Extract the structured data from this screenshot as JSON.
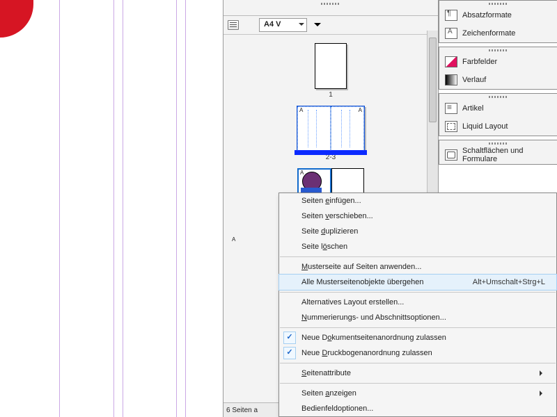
{
  "toolbar": {
    "page_template_label": "A4 V"
  },
  "pages": {
    "label_1": "1",
    "label_23": "2-3",
    "status": "6 Seiten a"
  },
  "right_panels": {
    "absatzformate": "Absatzformate",
    "zeichenformate": "Zeichenformate",
    "farbfelder": "Farbfelder",
    "verlauf": "Verlauf",
    "artikel": "Artikel",
    "liquid_layout": "Liquid Layout",
    "schaltflaechen": "Schaltflächen und Formulare"
  },
  "context_menu": {
    "seiten_einfuegen": {
      "pre": "Seiten ",
      "u": "e",
      "post": "infügen..."
    },
    "seiten_verschieben": {
      "pre": "Seiten ",
      "u": "v",
      "post": "erschieben..."
    },
    "seite_duplizieren": {
      "pre": "Seite ",
      "u": "d",
      "post": "uplizieren"
    },
    "seite_loeschen": {
      "pre": "Seite l",
      "u": "ö",
      "post": "schen"
    },
    "musterseite_anwenden": {
      "u": "M",
      "post": "usterseite auf Seiten anwenden..."
    },
    "alle_muster_uebergehen": {
      "text": "Alle Musterseitenobjekte übergehen",
      "shortcut": "Alt+Umschalt+Strg+L"
    },
    "alternatives_layout": {
      "text": "Alternatives Layout erstellen..."
    },
    "nummerierung": {
      "u": "N",
      "post": "ummerierungs- und Abschnittsoptionen..."
    },
    "dokumentseitenanordnung": {
      "pre": "Neue D",
      "u": "o",
      "post": "kumentseitenanordnung zulassen"
    },
    "druckbogenanordnung": {
      "pre": "Neue ",
      "u": "D",
      "post": "ruckbogenanordnung zulassen"
    },
    "seitenattribute": {
      "pre": "",
      "u": "S",
      "post": "eitenattribute"
    },
    "seiten_anzeigen": {
      "pre": "Seiten ",
      "u": "a",
      "post": "nzeigen"
    },
    "bedienfeldoptionen": {
      "text": "Bedienfeldoptionen..."
    }
  }
}
